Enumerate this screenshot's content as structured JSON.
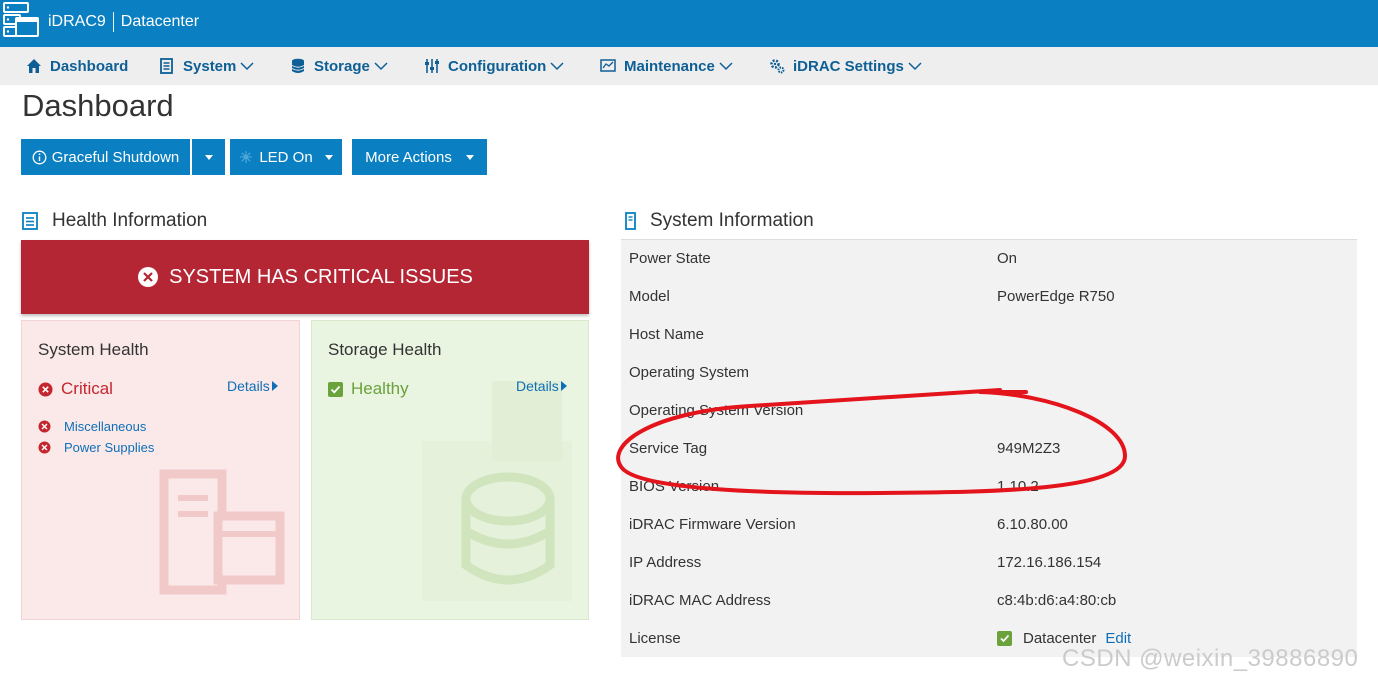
{
  "app": {
    "product": "iDRAC9",
    "context": "Datacenter"
  },
  "nav": {
    "dashboard": "Dashboard",
    "system": "System",
    "storage": "Storage",
    "configuration": "Configuration",
    "maintenance": "Maintenance",
    "idrac_settings": "iDRAC Settings"
  },
  "page_title": "Dashboard",
  "actions": {
    "graceful_shutdown": "Graceful Shutdown",
    "led_on": "LED On",
    "more_actions": "More Actions"
  },
  "health": {
    "title": "Health Information",
    "banner": "SYSTEM HAS CRITICAL ISSUES",
    "details_label": "Details",
    "system": {
      "title": "System Health",
      "status": "Critical",
      "issues": [
        "Miscellaneous",
        "Power Supplies"
      ]
    },
    "storage": {
      "title": "Storage Health",
      "status": "Healthy"
    }
  },
  "system_info": {
    "title": "System Information",
    "rows": [
      {
        "label": "Power State",
        "value": "On"
      },
      {
        "label": "Model",
        "value": "PowerEdge R750"
      },
      {
        "label": "Host Name",
        "value": ""
      },
      {
        "label": "Operating System",
        "value": ""
      },
      {
        "label": "Operating System Version",
        "value": ""
      },
      {
        "label": "Service Tag",
        "value": "949M2Z3"
      },
      {
        "label": "BIOS Version",
        "value": "1.10.2"
      },
      {
        "label": "iDRAC Firmware Version",
        "value": "6.10.80.00"
      },
      {
        "label": "IP Address",
        "value": "172.16.186.154"
      },
      {
        "label": "iDRAC MAC Address",
        "value": "c8:4b:d6:a4:80:cb"
      },
      {
        "label": "License",
        "value": "Datacenter"
      }
    ],
    "license_edit": "Edit"
  },
  "watermark": "CSDN @weixin_39886890",
  "colors": {
    "brand_blue": "#0a7fc1",
    "nav_text": "#0e5f96",
    "critical_red": "#b52635",
    "healthy_green": "#6aa23c",
    "annotation_red": "#e3141b"
  }
}
